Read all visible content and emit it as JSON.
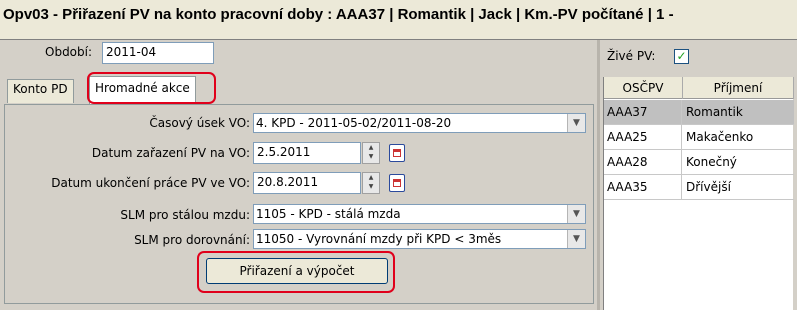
{
  "window": {
    "title": "Opv03 - Přiřazení PV na konto pracovní doby : AAA37 | Romantik | Jack | Km.-PV počítané | 1 -"
  },
  "period": {
    "label": "Období:",
    "value": "2011-04"
  },
  "tabs": [
    {
      "label": "Konto PD",
      "active": false
    },
    {
      "label": "Hromadné akce",
      "active": true
    }
  ],
  "form": {
    "time_section": {
      "label": "Časový úsek VO:",
      "value": "4. KPD - 2011-05-02/2011-08-20"
    },
    "assign_date": {
      "label": "Datum zařazení PV na VO:",
      "value": "2.5.2011"
    },
    "end_date": {
      "label": "Datum ukončení práce PV ve VO:",
      "value": "20.8.2011"
    },
    "slm_fixed": {
      "label": "SLM pro stálou mzdu:",
      "value": "1105 - KPD - stálá mzda"
    },
    "slm_adjust": {
      "label": "SLM pro dorovnání:",
      "value": "11050 - Vyrovnání mzdy při KPD < 3měs"
    },
    "submit_label": "Přiřazení a výpočet"
  },
  "live_pv": {
    "label": "Živé PV:",
    "checked": true,
    "mark": "✓"
  },
  "grid": {
    "columns": [
      "OSČPV",
      "Příjmení"
    ],
    "rows": [
      {
        "id": "AAA37",
        "name": "Romantik",
        "selected": true
      },
      {
        "id": "AAA25",
        "name": "Makačenko",
        "selected": false
      },
      {
        "id": "AAA28",
        "name": "Konečný",
        "selected": false
      },
      {
        "id": "AAA35",
        "name": "Dřívější",
        "selected": false
      }
    ]
  },
  "colors": {
    "highlight": "#e0001b",
    "check": "#21a121"
  }
}
